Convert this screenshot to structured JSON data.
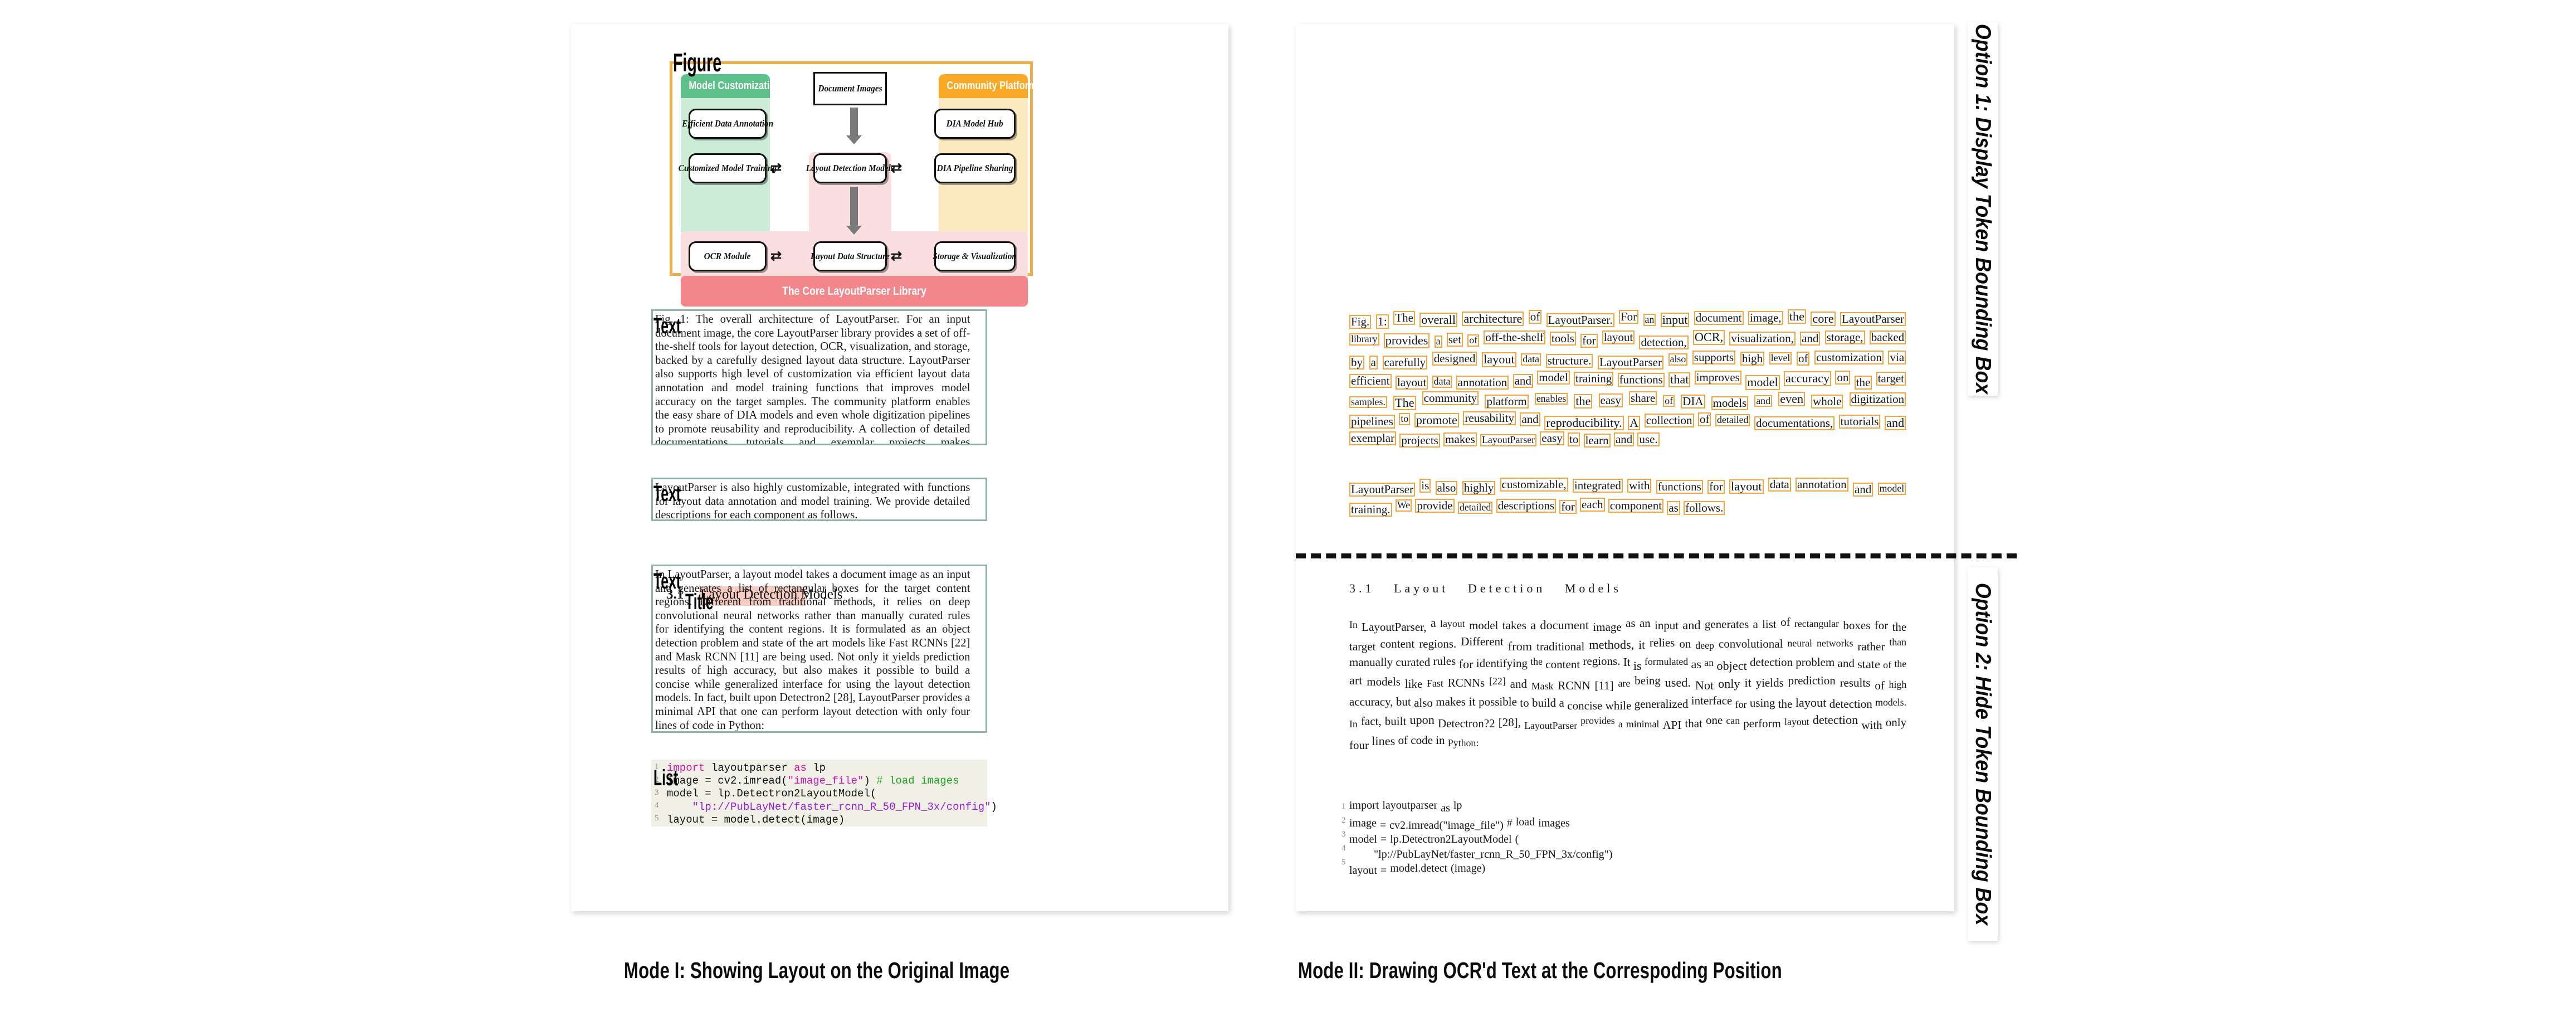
{
  "captions": {
    "left": "Mode I: Showing Layout on the Original Image",
    "right": "Mode II: Drawing OCR'd Text at the Correspoding Position"
  },
  "side_labels": {
    "option1": "Option 1: Display Token Bounding Box",
    "option2": "Option 2: Hide Token Bounding Box"
  },
  "colors": {
    "figure_frame": "#efae49",
    "model_customization_header": "#5ec08b",
    "model_customization_body": "#cdecd8",
    "community_platform_header": "#f9a926",
    "community_platform_body": "#fde9c0",
    "core_library_band": "#f2868b",
    "core_library_body": "#fbdfe0",
    "text_region_border": "#93b3a4",
    "title_region_highlight": "#f7ccc3",
    "token_box_border": "#f0a63c",
    "list_region_bg": "#f0f0e6"
  },
  "figure": {
    "region_label": "Figure",
    "columns": {
      "left_title": "Model Customization",
      "right_title": "Community Platform",
      "core_band": "The Core LayoutParser Library"
    },
    "nodes": {
      "document_images": "Document Images",
      "efficient_data_annotation": "Efficient Data Annotation",
      "customized_model_training": "Customized Model Training",
      "ocr_module": "OCR Module",
      "layout_detection_models": "Layout Detection Models",
      "layout_data_structure": "Layout Data Structure",
      "dia_model_hub": "DIA Model Hub",
      "dia_pipeline_sharing": "DIA Pipeline Sharing",
      "storage_visualization": "Storage & Visualization"
    }
  },
  "region_labels": {
    "text": "Text",
    "title": "Title",
    "list": "List"
  },
  "document": {
    "caption_paragraph": "Fig. 1: The overall architecture of LayoutParser. For an input document image, the core LayoutParser library provides a set of off-the-shelf tools for layout detection, OCR, visualization, and storage, backed by a carefully designed layout data structure. LayoutParser also supports high level of customization via efficient layout data annotation and model training functions that improves model accuracy on the target samples. The community platform enables the easy share of DIA models and even whole digitization pipelines to promote reusability and reproducibility. A collection of detailed documentations, tutorials and exemplar projects makes LayoutParser easy to learn and use.",
    "second_paragraph": "LayoutParser is also highly customizable, integrated with functions for layout data annotation and model training. We provide detailed descriptions for each component as follows.",
    "section_number": "3.1",
    "section_title": "Layout Detection Models",
    "body_paragraph": "In LayoutParser, a layout model takes a document image as an input and generates a list of rectangular boxes for the target content regions. Different from traditional methods, it relies on deep convolutional neural networks rather than manually curated rules for identifying the content regions. It is formulated as an object detection problem and state of the art models like Fast RCNNs [22] and Mask RCNN [11] are being used. Not only it yields prediction results of high accuracy, but also makes it possible to build a concise while generalized interface for using the layout detection models. In fact, built upon Detectron2 [28], LayoutParser provides a minimal API that one can perform layout detection with only four lines of code in Python:",
    "code_lines": [
      "import layoutparser as lp",
      "image = cv2.imread(\"image_file\") # load images",
      "model = lp.Detectron2LayoutModel(",
      "    \"lp://PubLayNet/faster_rcnn_R_50_FPN_3x/config\")",
      "layout = model.detect(image)"
    ],
    "code_line_numbers": [
      "1",
      "2",
      "3",
      "4",
      "5"
    ]
  },
  "ocr_tokens": {
    "caption_paragraph": [
      "Fig.",
      "1:",
      "The",
      "overall",
      "architecture",
      "of",
      "LayoutParser.",
      "For",
      "an",
      "input",
      "document",
      "image,",
      "the",
      "core",
      "LayoutParser",
      "library",
      "provides",
      "a",
      "set",
      "of",
      "off-the-shelf",
      "tools",
      "for",
      "layout",
      "detection,",
      "OCR,",
      "visualization,",
      "and",
      "storage,",
      "backed",
      "by",
      "a",
      "carefully",
      "designed",
      "layout",
      "data",
      "structure.",
      "LayoutParser",
      "also",
      "supports",
      "high",
      "level",
      "of",
      "customization",
      "via",
      "efficient",
      "layout",
      "data",
      "annotation",
      "and",
      "model",
      "training",
      "functions",
      "that",
      "improves",
      "model",
      "accuracy",
      "on",
      "the",
      "target",
      "samples.",
      "The",
      "community",
      "platform",
      "enables",
      "the",
      "easy",
      "share",
      "of",
      "DIA",
      "models",
      "and",
      "even",
      "whole",
      "digitization",
      "pipelines",
      "to",
      "promote",
      "reusability",
      "and",
      "reproducibility.",
      "A",
      "collection",
      "of",
      "detailed",
      "documentations,",
      "tutorials",
      "and",
      "exemplar",
      "projects",
      "makes",
      "LayoutParser",
      "easy",
      "to",
      "learn",
      "and",
      "use."
    ],
    "second_paragraph": [
      "LayoutParser",
      "is",
      "also",
      "highly",
      "customizable,",
      "integrated",
      "with",
      "functions",
      "for",
      "layout",
      "data",
      "annotation",
      "and",
      "model",
      "training.",
      "We",
      "provide",
      "detailed",
      "descriptions",
      "for",
      "each",
      "component",
      "as",
      "follows."
    ],
    "section_heading": [
      "3.1",
      "Layout",
      "Detection",
      "Models"
    ],
    "body_paragraph": [
      "In",
      "LayoutParser,",
      "a",
      "layout",
      "model",
      "takes",
      "a",
      "document",
      "image",
      "as",
      "an",
      "input",
      "and",
      "generates",
      "a",
      "list",
      "of",
      "rectangular",
      "boxes",
      "for",
      "the",
      "target",
      "content",
      "regions.",
      "Different",
      "from",
      "traditional",
      "methods,",
      "it",
      "relies",
      "on",
      "deep",
      "convolutional",
      "neural",
      "networks",
      "rather",
      "than",
      "manually",
      "curated",
      "rules",
      "for",
      "identifying",
      "the",
      "content",
      "regions.",
      "It",
      "is",
      "formulated",
      "as",
      "an",
      "object",
      "detection",
      "problem",
      "and",
      "state",
      "of",
      "the",
      "art",
      "models",
      "like",
      "Fast",
      "RCNNs",
      "[22]",
      "and",
      "Mask",
      "RCNN",
      "[11]",
      "are",
      "being",
      "used.",
      "Not",
      "only",
      "it",
      "yields",
      "prediction",
      "results",
      "of",
      "high",
      "accuracy,",
      "but",
      "also",
      "makes",
      "it",
      "possible",
      "to",
      "build",
      "a",
      "concise",
      "while",
      "generalized",
      "interface",
      "for",
      "using",
      "the",
      "layout",
      "detection",
      "models.",
      "In",
      "fact,",
      "built",
      "upon",
      "Detectron?2",
      "[28],",
      "LayoutParser",
      "provides",
      "a",
      "minimal",
      "API",
      "that",
      "one",
      "can",
      "perform",
      "layout",
      "detection",
      "with",
      "only",
      "four",
      "lines",
      "of",
      "code",
      "in",
      "Python:"
    ],
    "code_tokens": [
      [
        "import",
        "layoutparser",
        "as",
        "lp"
      ],
      [
        "image",
        "=",
        "cv2.imread(\"image_file\")",
        "#",
        "load",
        "images"
      ],
      [
        "model",
        "=",
        "lp.Detectron2LayoutModel",
        "("
      ],
      [
        "\"lp://PubLayNet/faster_rcnn_R_50_FPN_3x/config\")"
      ],
      [
        "layout",
        "=",
        "model.detect",
        "(image)"
      ]
    ],
    "code_line_numbers": [
      "1",
      "2",
      "3",
      "4",
      "5"
    ]
  }
}
